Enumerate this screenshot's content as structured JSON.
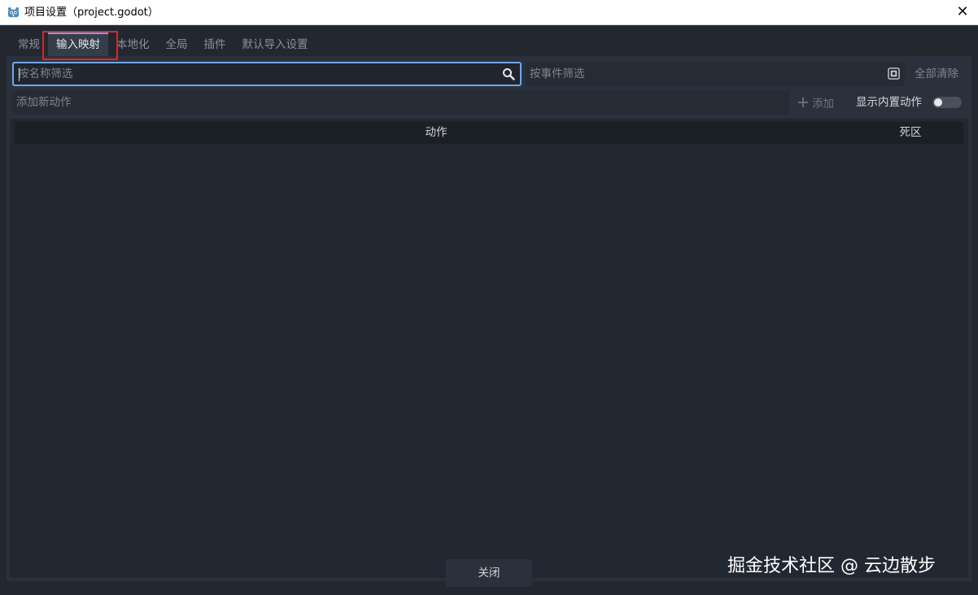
{
  "window": {
    "title": "项目设置（project.godot）",
    "close_symbol": "✕"
  },
  "tabs": [
    {
      "label": "常规",
      "active": false
    },
    {
      "label": "输入映射",
      "active": true
    },
    {
      "label": "本地化",
      "active": false
    },
    {
      "label": "全局",
      "active": false
    },
    {
      "label": "插件",
      "active": false
    },
    {
      "label": "默认导入设置",
      "active": false
    }
  ],
  "filters": {
    "name_placeholder": "按名称筛选",
    "event_placeholder": "按事件筛选",
    "clear_all_label": "全部清除"
  },
  "new_action": {
    "placeholder": "添加新动作",
    "add_label": "添加",
    "show_builtin_label": "显示内置动作",
    "show_builtin_enabled": false
  },
  "tree": {
    "columns": [
      "动作",
      "死区"
    ]
  },
  "footer": {
    "close_label": "关闭"
  },
  "watermark": "掘金技术社区 @ 云边散步",
  "colors": {
    "accent": "#6ea7e8",
    "highlight": "#e0242b",
    "background": "#232830"
  },
  "icons": {
    "app": "godot-icon",
    "search": "search-icon",
    "event": "keyboard-icon",
    "add": "plus-icon"
  }
}
